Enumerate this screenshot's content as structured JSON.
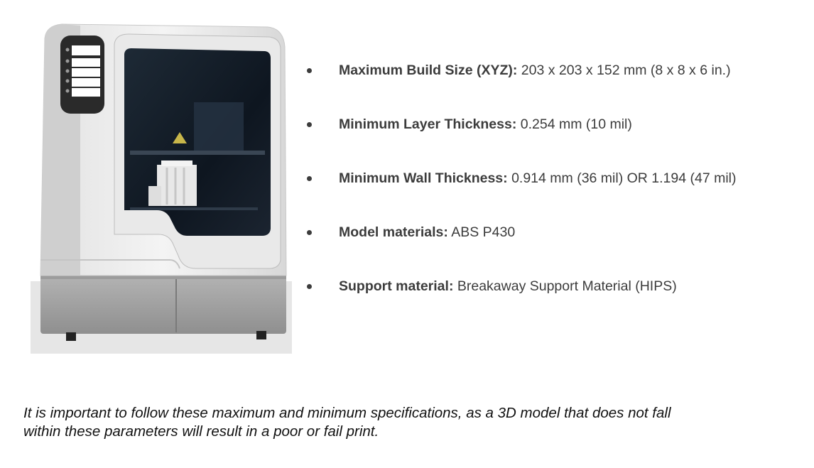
{
  "specs": [
    {
      "label": "Maximum Build Size (XYZ):",
      "value": " 203 x 203 x 152 mm (8 x 8 x 6 in.)"
    },
    {
      "label": "Minimum Layer Thickness:",
      "value": " 0.254 mm (10 mil)"
    },
    {
      "label": "Minimum Wall Thickness:",
      "value": " 0.914 mm (36 mil) OR 1.194 (47 mil)"
    },
    {
      "label": "Model materials:",
      "value": " ABS P430"
    },
    {
      "label": "Support material:",
      "value": " Breakaway Support Material (HIPS)"
    }
  ],
  "note": {
    "line1": "It is important to follow these maximum and minimum specifications, as a 3D model that does not fall",
    "line2": "within these parameters will result in a poor or fail print."
  }
}
